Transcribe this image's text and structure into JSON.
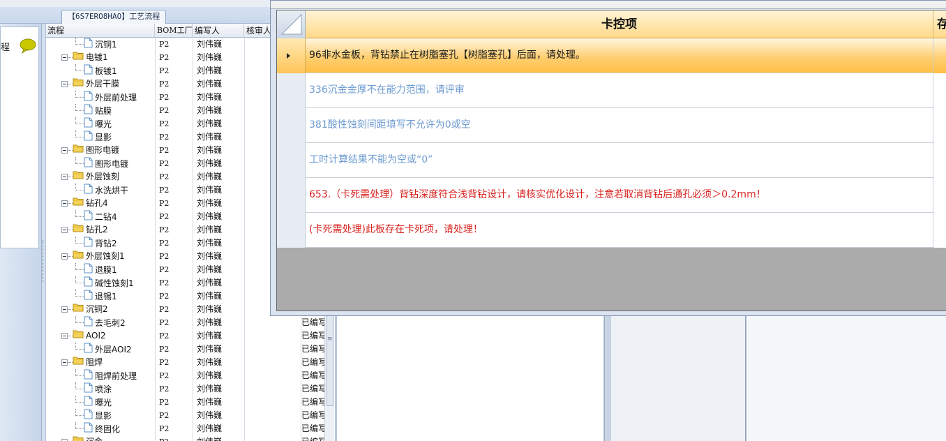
{
  "window_tab": {
    "title": "【6S7ERO8HAO】工艺流程"
  },
  "left_panel": {
    "label": "程"
  },
  "tree_grid": {
    "columns": [
      "流程",
      "BOM工厂",
      "编写人",
      "核审人"
    ],
    "rows": [
      {
        "name": "沉铜1",
        "level": 2,
        "bom": "P2",
        "writer": "刘伟巍",
        "status": ""
      },
      {
        "name": "电镀1",
        "level": 1,
        "bom": "P2",
        "writer": "刘伟巍",
        "status": ""
      },
      {
        "name": "板镀1",
        "level": 2,
        "bom": "P2",
        "writer": "刘伟巍",
        "status": ""
      },
      {
        "name": "外层干膜",
        "level": 1,
        "bom": "P2",
        "writer": "刘伟巍",
        "status": ""
      },
      {
        "name": "外层前处理",
        "level": 2,
        "bom": "P2",
        "writer": "刘伟巍",
        "status": ""
      },
      {
        "name": "贴膜",
        "level": 2,
        "bom": "P2",
        "writer": "刘伟巍",
        "status": ""
      },
      {
        "name": "曝光",
        "level": 2,
        "bom": "P2",
        "writer": "刘伟巍",
        "status": ""
      },
      {
        "name": "显影",
        "level": 2,
        "bom": "P2",
        "writer": "刘伟巍",
        "status": ""
      },
      {
        "name": "图形电镀",
        "level": 1,
        "bom": "P2",
        "writer": "刘伟巍",
        "status": ""
      },
      {
        "name": "图形电镀",
        "level": 2,
        "bom": "P2",
        "writer": "刘伟巍",
        "status": ""
      },
      {
        "name": "外层蚀刻",
        "level": 1,
        "bom": "P2",
        "writer": "刘伟巍",
        "status": ""
      },
      {
        "name": "水洗烘干",
        "level": 2,
        "bom": "P2",
        "writer": "刘伟巍",
        "status": ""
      },
      {
        "name": "钻孔4",
        "level": 1,
        "bom": "P2",
        "writer": "刘伟巍",
        "status": ""
      },
      {
        "name": "二钻4",
        "level": 2,
        "bom": "P2",
        "writer": "刘伟巍",
        "status": ""
      },
      {
        "name": "钻孔2",
        "level": 1,
        "bom": "P2",
        "writer": "刘伟巍",
        "status": ""
      },
      {
        "name": "背钻2",
        "level": 2,
        "bom": "P2",
        "writer": "刘伟巍",
        "status": ""
      },
      {
        "name": "外层蚀刻1",
        "level": 1,
        "bom": "P2",
        "writer": "刘伟巍",
        "status": ""
      },
      {
        "name": "退膜1",
        "level": 2,
        "bom": "P2",
        "writer": "刘伟巍",
        "status": ""
      },
      {
        "name": "碱性蚀刻1",
        "level": 2,
        "bom": "P2",
        "writer": "刘伟巍",
        "status": ""
      },
      {
        "name": "退锡1",
        "level": 2,
        "bom": "P2",
        "writer": "刘伟巍",
        "status": ""
      },
      {
        "name": "沉铜2",
        "level": 1,
        "bom": "P2",
        "writer": "刘伟巍",
        "status": ""
      },
      {
        "name": "去毛刺2",
        "level": 2,
        "bom": "P2",
        "writer": "刘伟巍",
        "status": "已编写"
      },
      {
        "name": "AOI2",
        "level": 1,
        "bom": "P2",
        "writer": "刘伟巍",
        "status": "已编写"
      },
      {
        "name": "外层AOI2",
        "level": 2,
        "bom": "P2",
        "writer": "刘伟巍",
        "status": "已编写"
      },
      {
        "name": "阻焊",
        "level": 1,
        "bom": "P2",
        "writer": "刘伟巍",
        "status": "已编写"
      },
      {
        "name": "阻焊前处理",
        "level": 2,
        "bom": "P2",
        "writer": "刘伟巍",
        "status": "已编写"
      },
      {
        "name": "喷涂",
        "level": 2,
        "bom": "P2",
        "writer": "刘伟巍",
        "status": "已编写"
      },
      {
        "name": "曝光",
        "level": 2,
        "bom": "P2",
        "writer": "刘伟巍",
        "status": "已编写"
      },
      {
        "name": "显影",
        "level": 2,
        "bom": "P2",
        "writer": "刘伟巍",
        "status": "已编写"
      },
      {
        "name": "终固化",
        "level": 2,
        "bom": "P2",
        "writer": "刘伟巍",
        "status": "已编写"
      },
      {
        "name": "沉金",
        "level": 1,
        "bom": "P2",
        "writer": "刘伟巍",
        "status": "已编写"
      }
    ]
  },
  "check_dialog": {
    "header": {
      "main": "卡控项",
      "next": "存"
    },
    "rows": [
      {
        "text": "96非水金板，背钻禁止在树脂塞孔【树脂塞孔】后面，请处理。",
        "color": "#1a1a1a",
        "active": true
      },
      {
        "text": "336沉金金厚不在能力范围，请评审",
        "color": "#6e9bd1",
        "active": false
      },
      {
        "text": "381酸性蚀刻间距填写不允许为0或空",
        "color": "#6e9bd1",
        "active": false
      },
      {
        "text": "工时计算结果不能为空或“0”",
        "color": "#6e9bd1",
        "active": false
      },
      {
        "text": "653.（卡死需处理）背钻深度符合浅背钻设计，请核实优化设计，注意若取消背钻后通孔必须＞0.2mm！",
        "color": "#d8231f",
        "active": false
      },
      {
        "text": "(卡死需处理)此板存在卡死项，请处理！",
        "color": "#d8231f",
        "active": false
      }
    ]
  },
  "colors": {
    "accent_row": "#ffcf73",
    "warning_text": "#d8231f",
    "info_text": "#6e9bd1"
  },
  "icons": {
    "folder": "folder-icon",
    "document": "document-icon",
    "chat": "chat-bubble-icon"
  }
}
